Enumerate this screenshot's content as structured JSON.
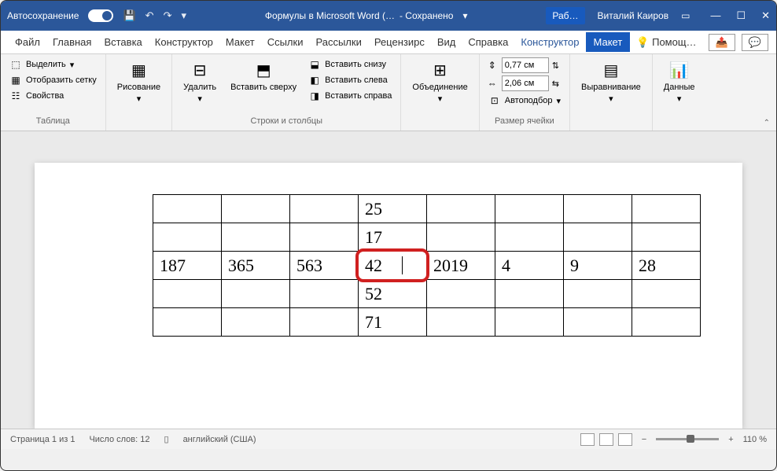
{
  "titlebar": {
    "autosave": "Автосохранение",
    "doc_title": "Формулы в Microsoft Word (…",
    "saved": "- Сохранено",
    "tab": "Раб…",
    "user": "Виталий Каиров"
  },
  "menu": {
    "file": "Файл",
    "home": "Главная",
    "insert": "Вставка",
    "designer": "Конструктор",
    "layout": "Макет",
    "links": "Ссылки",
    "mailings": "Рассылки",
    "review": "Рецензирс",
    "view": "Вид",
    "help": "Справка",
    "table_design": "Конструктор",
    "table_layout": "Макет",
    "tell": "Помощ…"
  },
  "ribbon": {
    "select": "Выделить",
    "grid": "Отобразить сетку",
    "props": "Свойства",
    "table_group": "Таблица",
    "draw": "Рисование",
    "delete": "Удалить",
    "insert_above": "Вставить сверху",
    "insert_below": "Вставить снизу",
    "insert_left": "Вставить слева",
    "insert_right": "Вставить справа",
    "rows_cols_group": "Строки и столбцы",
    "merge": "Объединение",
    "height": "0,77 см",
    "width": "2,06 см",
    "autofit": "Автоподбор",
    "cell_size_group": "Размер ячейки",
    "align": "Выравнивание",
    "data": "Данные"
  },
  "table": {
    "r1": [
      "",
      "",
      "",
      "25",
      "",
      "",
      "",
      ""
    ],
    "r2": [
      "",
      "",
      "",
      "17",
      "",
      "",
      "",
      ""
    ],
    "r3": [
      "187",
      "365",
      "563",
      "42",
      "2019",
      "4",
      "9",
      "28"
    ],
    "r4": [
      "",
      "",
      "",
      "52",
      "",
      "",
      "",
      ""
    ],
    "r5": [
      "",
      "",
      "",
      "71",
      "",
      "",
      "",
      ""
    ]
  },
  "status": {
    "page": "Страница 1 из 1",
    "words": "Число слов: 12",
    "lang": "английский (США)",
    "zoom": "110 %"
  }
}
